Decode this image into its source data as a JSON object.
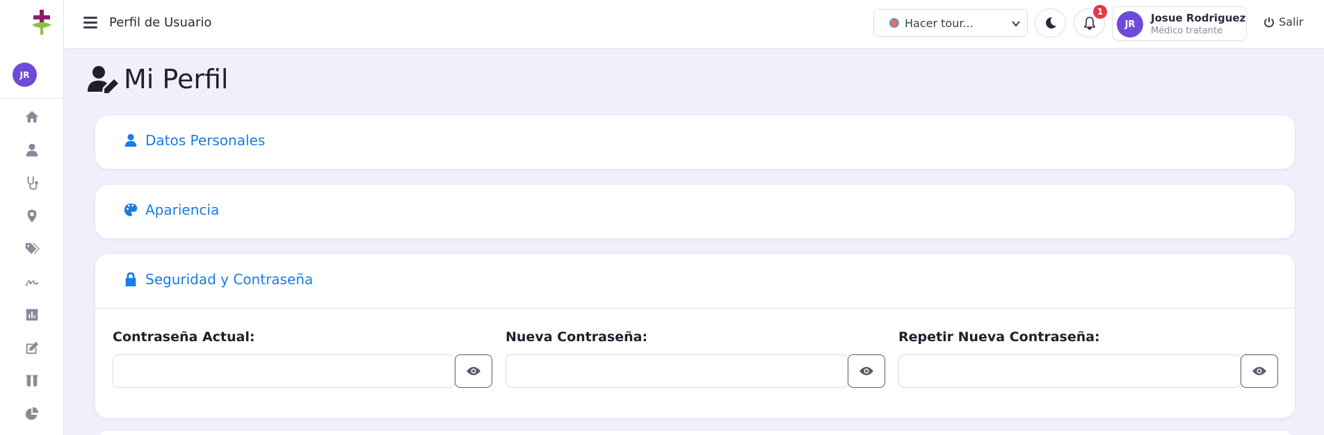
{
  "header": {
    "title": "Perfil de Usuario",
    "tour_select": "Hacer tour...",
    "notification_count": "1",
    "user": {
      "initials": "JR",
      "name": "Josue Rodriguez",
      "role": "Médico tratante"
    },
    "logout_label": "Salir"
  },
  "sidebar": {
    "avatar_initials": "JR",
    "items": [
      {
        "icon": "home-icon"
      },
      {
        "icon": "user-icon"
      },
      {
        "icon": "stethoscope-icon"
      },
      {
        "icon": "location-pin-icon"
      },
      {
        "icon": "tags-icon"
      },
      {
        "icon": "signature-icon"
      },
      {
        "icon": "chart-icon"
      },
      {
        "icon": "edit-icon"
      },
      {
        "icon": "test-tubes-icon"
      },
      {
        "icon": "pie-chart-icon"
      }
    ]
  },
  "page": {
    "title": "Mi Perfil"
  },
  "sections": {
    "personal": "Datos Personales",
    "appearance": "Apariencia",
    "security": "Seguridad y Contraseña"
  },
  "password_form": {
    "current_label": "Contraseña Actual:",
    "new_label": "Nueva Contraseña:",
    "repeat_label": "Repetir Nueva Contraseña:",
    "current_value": "",
    "new_value": "",
    "repeat_value": ""
  },
  "colors": {
    "accent": "#1a7ce6",
    "avatar": "#6c4cd6",
    "badge": "#e53945",
    "background": "#f1effc"
  }
}
